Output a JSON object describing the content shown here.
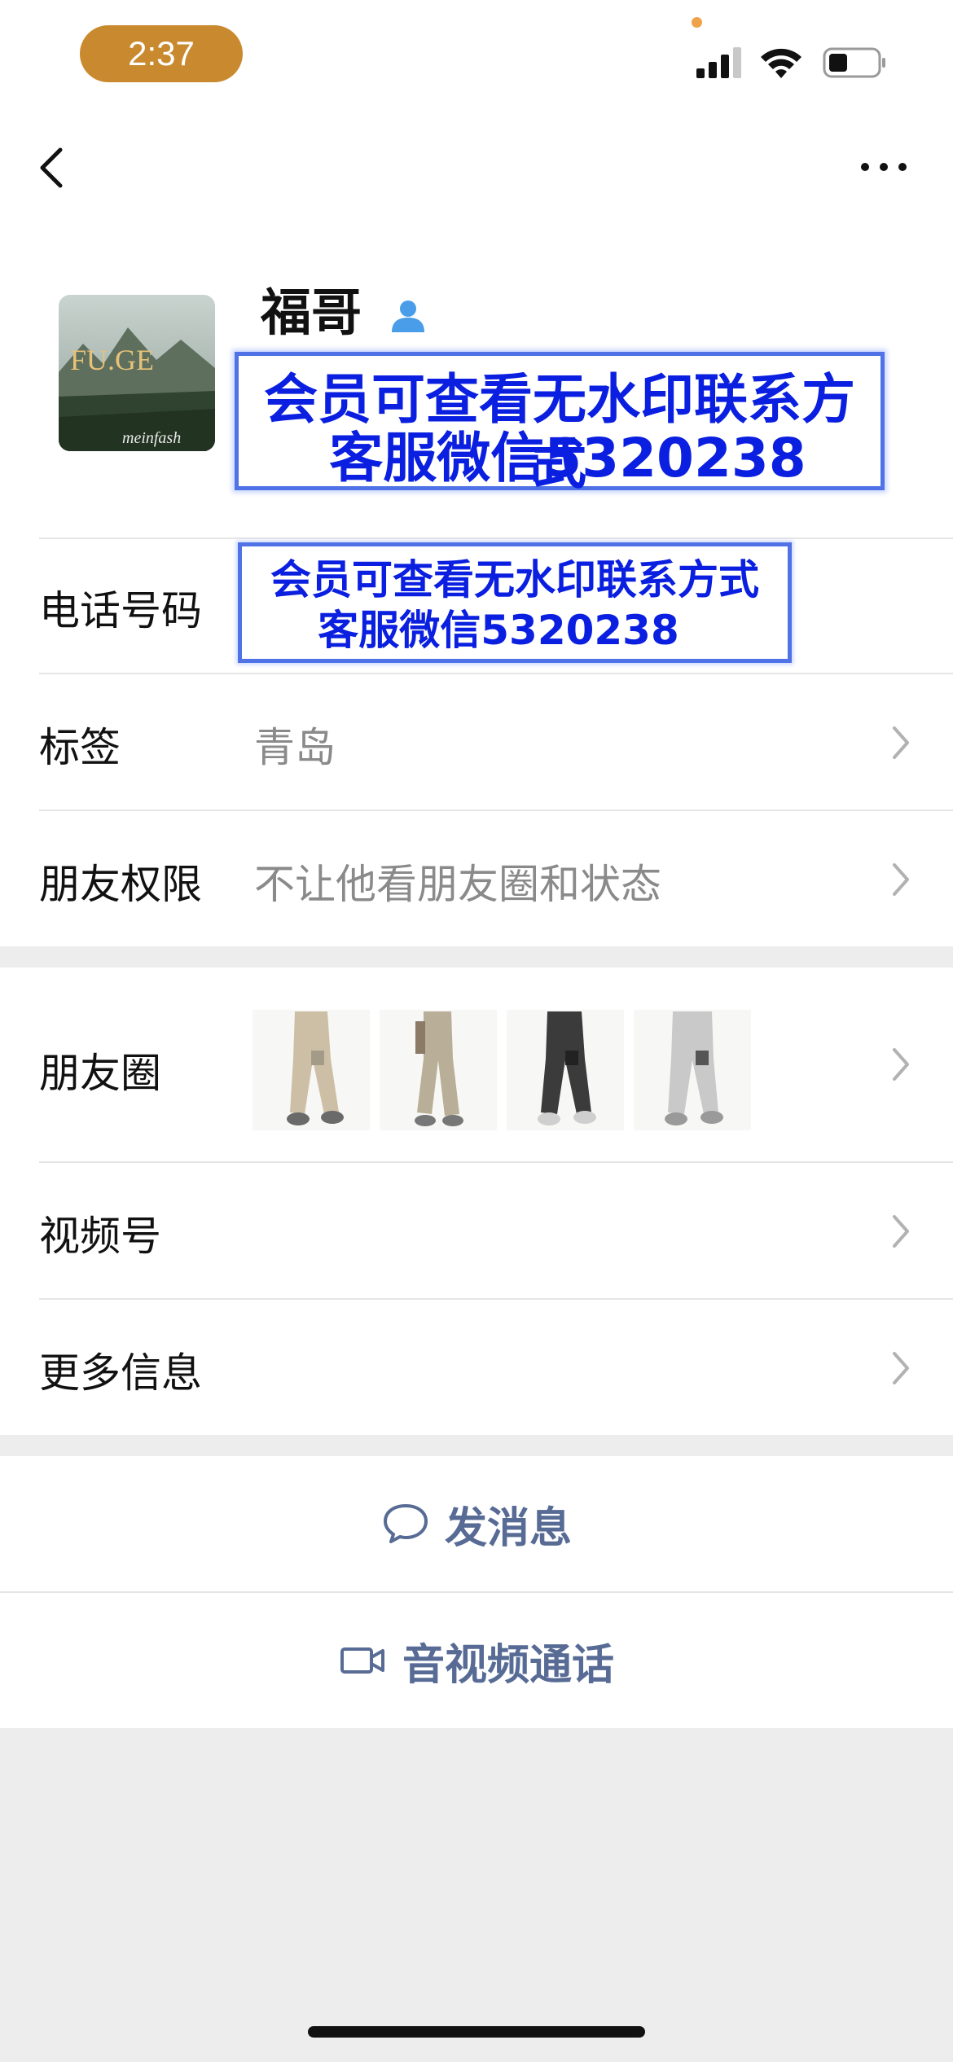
{
  "status_bar": {
    "time": "2:37",
    "icons": [
      "signal-icon",
      "wifi-icon",
      "battery-icon"
    ],
    "time_pill_color": "#c98a2f"
  },
  "nav": {
    "back_icon": "chevron-left-icon",
    "more_icon": "ellipsis-icon"
  },
  "profile": {
    "avatar_text_main": "FU.GE",
    "avatar_text_script": "meinfash",
    "name": "福哥",
    "name_badge_icon": "person-icon",
    "watermark_line1": "会员可查看无水印联系方式",
    "watermark_line2": "客服微信5320238"
  },
  "rows": {
    "phone": {
      "label": "电话号码",
      "watermark_line1": "会员可查看无水印联系方式",
      "watermark_line2": "客服微信5320238"
    },
    "tags": {
      "label": "标签",
      "value": "青岛"
    },
    "permissions": {
      "label": "朋友权限",
      "value": "不让他看朋友圈和状态"
    },
    "moments": {
      "label": "朋友圈",
      "thumbnails": [
        "beige-jogger-pants",
        "khaki-jogger-pants",
        "dark-grey-jogger-pants",
        "light-grey-jogger-pants"
      ]
    },
    "channels": {
      "label": "视频号"
    },
    "more_info": {
      "label": "更多信息"
    }
  },
  "actions": {
    "message": {
      "label": "发消息",
      "icon": "chat-bubble-icon"
    },
    "call": {
      "label": "音视频通话",
      "icon": "video-camera-icon"
    }
  },
  "colors": {
    "accent": "#576b95",
    "watermark_text": "#0a1fe0",
    "watermark_border": "#4f72e6",
    "page_background": "#ededed"
  }
}
